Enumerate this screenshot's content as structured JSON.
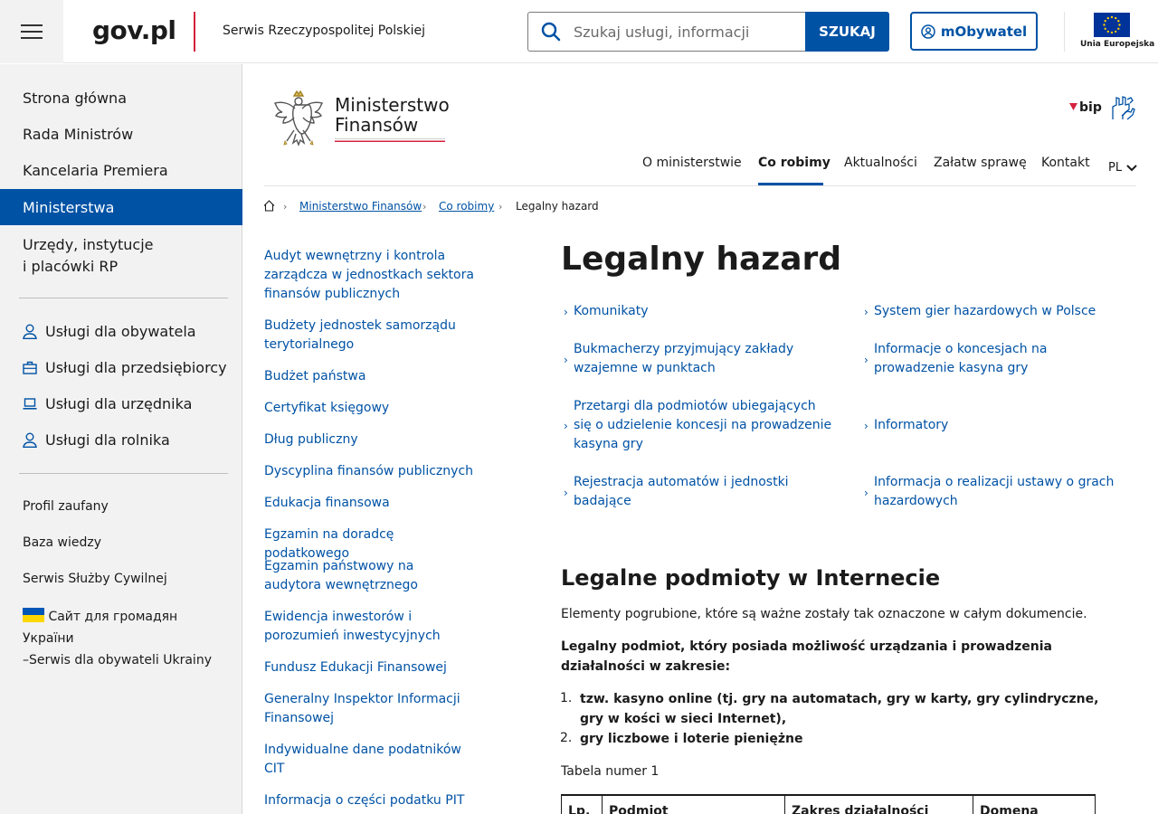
{
  "header": {
    "logo": "gov.pl",
    "service_name": "Serwis Rzeczypospolitej Polskiej",
    "search_placeholder": "Szukaj usługi, informacji",
    "search_button": "SZUKAJ",
    "mobywatel_button": "mObywatel",
    "eu_label": "Unia Europejska"
  },
  "sidebar": {
    "main_items": [
      "Strona główna",
      "Rada Ministrów",
      "Kancelaria Premiera",
      "Ministerstwa",
      "Urzędy, instytucje",
      "i placówki RP"
    ],
    "active_index": 3,
    "services": [
      "Usługi dla obywatela",
      "Usługi dla przedsiębiorcy",
      "Usługi dla urzędnika",
      "Usługi dla rolnika"
    ],
    "small_items": [
      "Profil zaufany",
      "Baza wiedzy",
      "Serwis Służby Cywilnej"
    ],
    "ukraine_line1": "Сайт для громадян України",
    "ukraine_line2": "–Serwis dla obywateli Ukrainy"
  },
  "ministry": {
    "name_line1": "Ministerstwo",
    "name_line2": "Finansów",
    "bip": "bip"
  },
  "nav": {
    "items": [
      "O ministerstwie",
      "Co robimy",
      "Aktualności",
      "Załatw sprawę",
      "Kontakt"
    ],
    "active_index": 1,
    "language": "PL"
  },
  "breadcrumb": {
    "items": [
      "Ministerstwo Finansów",
      "Co robimy",
      "Legalny hazard"
    ]
  },
  "subnav": [
    "Audyt wewnętrzny i kontrola zarządcza w jednostkach sektora finansów publicznych",
    "Budżety jednostek samorządu terytorialnego",
    "Budżet państwa",
    "Certyfikat księgowy",
    "Dług publiczny",
    "Dyscyplina finansów publicznych",
    "Edukacja finansowa",
    "Egzamin na doradcę podatkowego",
    "Egzamin państwowy na audytora wewnętrznego",
    "Ewidencja inwestorów i porozumień inwestycyjnych",
    "Fundusz Edukacji Finansowej",
    "Generalny Inspektor Informacji Finansowej",
    "Indywidualne dane podatników CIT",
    "Informacja o części podatku PIT"
  ],
  "main": {
    "title": "Legalny hazard",
    "quick_links": [
      "Komunikaty",
      "System gier hazardowych w Polsce",
      "Bukmacherzy przyjmujący zakłady wzajemne w punktach",
      "Informacje o koncesjach na prowadzenie kasyna gry",
      "Przetargi dla podmiotów ubiegających się o udzielenie koncesji na prowadzenie kasyna gry",
      "Informatory",
      "Rejestracja automatów i jednostki badające",
      "Informacja o realizacji ustawy o grach hazardowych"
    ],
    "section_title": "Legalne podmioty w Internecie",
    "intro": "Elementy pogrubione, które są ważne zostały tak oznaczone w całym dokumencie.",
    "bold_para": "Legalny podmiot, który posiada możliwość urządzania i prowadzenia działalności w zakresie:",
    "list": [
      "tzw. kasyno online (tj. gry na automatach, gry w karty, gry cylindryczne, gry w kości w  sieci Internet),",
      "gry liczbowe i loterie pieniężne"
    ],
    "table_caption": "Tabela numer 1",
    "table_headers": [
      "Lp.",
      "Podmiot",
      "Zakres działalności",
      "Domena"
    ]
  },
  "colors": {
    "primary": "#0052a5",
    "accent_red": "#d4213d",
    "sidebar_bg": "#f2f2f2"
  }
}
